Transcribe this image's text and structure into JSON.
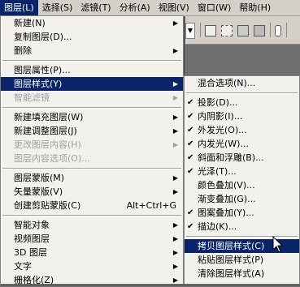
{
  "menubar": {
    "items": [
      {
        "label": "图层(L)",
        "active": true
      },
      {
        "label": "选择(S)"
      },
      {
        "label": "滤镜(T)"
      },
      {
        "label": "分析(A)"
      },
      {
        "label": "视图(V)"
      },
      {
        "label": "窗口(W)"
      },
      {
        "label": "帮助(H)"
      }
    ]
  },
  "toolbar": {
    "icons": [
      "dropdown-arrow-icon",
      "new-selection-icon",
      "add-selection-icon",
      "subtract-selection-icon",
      "intersect-selection-icon",
      "paperclip-icon"
    ]
  },
  "layer_menu": {
    "items": [
      {
        "label": "新建(N)",
        "arrow": true
      },
      {
        "label": "复制图层(D)..."
      },
      {
        "label": "删除",
        "arrow": true
      },
      {
        "sep": true
      },
      {
        "label": "图层属性(P)..."
      },
      {
        "label": "图层样式(Y)",
        "arrow": true,
        "highlight": true
      },
      {
        "label": "智能滤镜",
        "arrow": true,
        "disabled": true
      },
      {
        "sep": true
      },
      {
        "label": "新建填充图层(W)",
        "arrow": true
      },
      {
        "label": "新建调整图层(J)",
        "arrow": true
      },
      {
        "label": "更改图层内容(H)",
        "arrow": true,
        "disabled": true
      },
      {
        "label": "图层内容选项(O)...",
        "disabled": true
      },
      {
        "sep": true
      },
      {
        "label": "图层蒙版(M)",
        "arrow": true
      },
      {
        "label": "矢量蒙版(V)",
        "arrow": true
      },
      {
        "label": "创建剪贴蒙版(C)",
        "shortcut": "Alt+Ctrl+G"
      },
      {
        "sep": true
      },
      {
        "label": "智能对象",
        "arrow": true
      },
      {
        "label": "视频图层",
        "arrow": true
      },
      {
        "label": "3D 图层",
        "arrow": true
      },
      {
        "label": "文字",
        "arrow": true
      },
      {
        "label": "栅格化(Z)",
        "arrow": true
      }
    ]
  },
  "style_menu": {
    "items": [
      {
        "label": "混合选项(N)..."
      },
      {
        "sep": true
      },
      {
        "label": "投影(D)...",
        "checked": true
      },
      {
        "label": "内阴影(I)...",
        "checked": true
      },
      {
        "label": "外发光(O)...",
        "checked": true
      },
      {
        "label": "内发光(W)...",
        "checked": true
      },
      {
        "label": "斜面和浮雕(B)...",
        "checked": true
      },
      {
        "label": "光泽(T)...",
        "checked": true
      },
      {
        "label": "颜色叠加(V)..."
      },
      {
        "label": "渐变叠加(G)..."
      },
      {
        "label": "图案叠加(Y)...",
        "checked": true
      },
      {
        "label": "描边(K)...",
        "checked": true
      },
      {
        "sep": true
      },
      {
        "label": "拷贝图层样式(C)",
        "highlight": true
      },
      {
        "label": "粘贴图层样式(P)"
      },
      {
        "label": "清除图层样式(A)"
      }
    ]
  },
  "colors": {
    "menu_bg": "#f2f1ec",
    "highlight": "#0a246a",
    "menubar_bg": "#d4d0c8"
  }
}
